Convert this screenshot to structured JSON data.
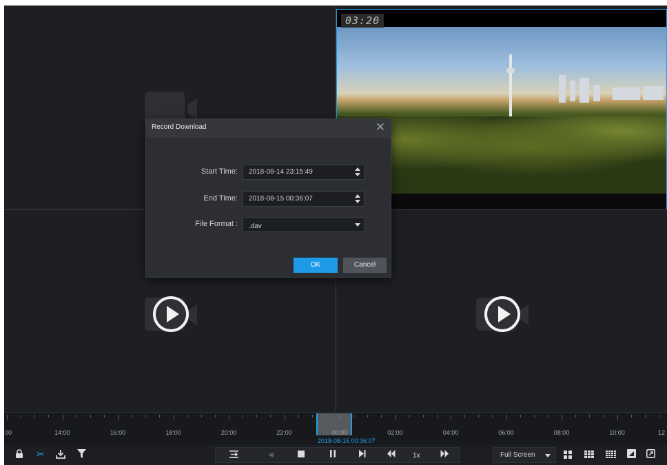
{
  "video": {
    "timestamp": "03:20"
  },
  "dialog": {
    "title": "Record Download",
    "close_icon": "close-icon",
    "start_label": "Start Time:",
    "start_value": "2018-08-14 23:15:49",
    "end_label": "End Time:",
    "end_value": "2018-08-15 00:36:07",
    "format_label": "File Format :",
    "format_value": ".dav",
    "ok_label": "OK",
    "cancel_label": "Cancel"
  },
  "timeline": {
    "labels": [
      "00",
      "14:00",
      "16:00",
      "18:00",
      "20:00",
      "22:00",
      "00:00",
      "02:00",
      "04:00",
      "06:00",
      "08:00",
      "10:00",
      "12"
    ],
    "cursor_time": "2018-08-15 00:36:07"
  },
  "controls": {
    "speed": "1x",
    "full_screen": "Full Screen"
  },
  "colors": {
    "accent": "#1ea0e6",
    "background": "#1c1e22",
    "dialog": "#2c2e33"
  }
}
